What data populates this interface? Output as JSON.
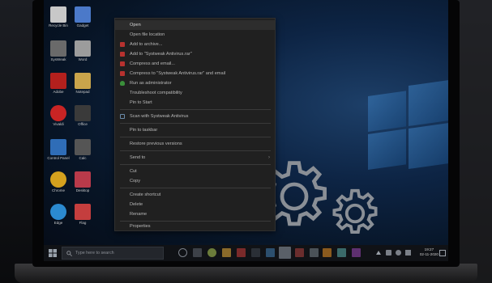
{
  "desktop_icons": [
    {
      "label": "Recycle Bin",
      "color": "#c8c8c8"
    },
    {
      "label": "Gadget",
      "color": "#4b79c9"
    },
    {
      "label": "SysWeak",
      "color": "#6a6a6a"
    },
    {
      "label": "Word",
      "color": "#9c9c9c"
    },
    {
      "label": "Adobe",
      "color": "#b3201d"
    },
    {
      "label": "Notepad",
      "color": "#c9a44b"
    },
    {
      "label": "Vivaldi",
      "color": "#c92424"
    },
    {
      "label": "Office",
      "color": "#3a3a3a"
    },
    {
      "label": "Control Panel",
      "color": "#2f6db7"
    },
    {
      "label": "Calc",
      "color": "#555"
    },
    {
      "label": "Chrome",
      "color": "#d4a11e"
    },
    {
      "label": "Desktop",
      "color": "#b93a4a"
    },
    {
      "label": "Edge",
      "color": "#2b8ad0"
    },
    {
      "label": "Flag",
      "color": "#c43e3e"
    }
  ],
  "context_menu": {
    "items": [
      {
        "label": "Open",
        "icon": "",
        "highlighted": true
      },
      {
        "label": "Open file location",
        "icon": ""
      },
      {
        "label": "Add to archive...",
        "icon": "rar-icon"
      },
      {
        "label": "Add to \"Systweak Antivirus.rar\"",
        "icon": "rar-icon"
      },
      {
        "label": "Compress and email...",
        "icon": "rar-icon"
      },
      {
        "label": "Compress to \"Systweak Antivirus.rar\" and email",
        "icon": "rar-icon"
      },
      {
        "label": "Run as administrator",
        "icon": "shield-icon"
      },
      {
        "label": "Troubleshoot compatibility",
        "icon": ""
      },
      {
        "label": "Pin to Start",
        "icon": ""
      },
      {
        "label": "Scan with Systweak Antivirus",
        "icon": "scan-icon"
      },
      {
        "label": "Pin to taskbar",
        "icon": ""
      },
      {
        "label": "Restore previous versions",
        "icon": ""
      },
      {
        "label": "Send to",
        "icon": "",
        "submenu": true
      },
      {
        "label": "Cut",
        "icon": ""
      },
      {
        "label": "Copy",
        "icon": ""
      },
      {
        "label": "Create shortcut",
        "icon": ""
      },
      {
        "label": "Delete",
        "icon": ""
      },
      {
        "label": "Rename",
        "icon": ""
      },
      {
        "label": "Properties",
        "icon": ""
      }
    ],
    "submenu_arrow": "›"
  },
  "taskbar": {
    "search_placeholder": "Type here to search",
    "time": "19:27",
    "date": "02-11-2020"
  },
  "colors": {
    "rar": "#b8322f",
    "shield": "#3a8f3a",
    "scan": "#6a8aa8"
  }
}
